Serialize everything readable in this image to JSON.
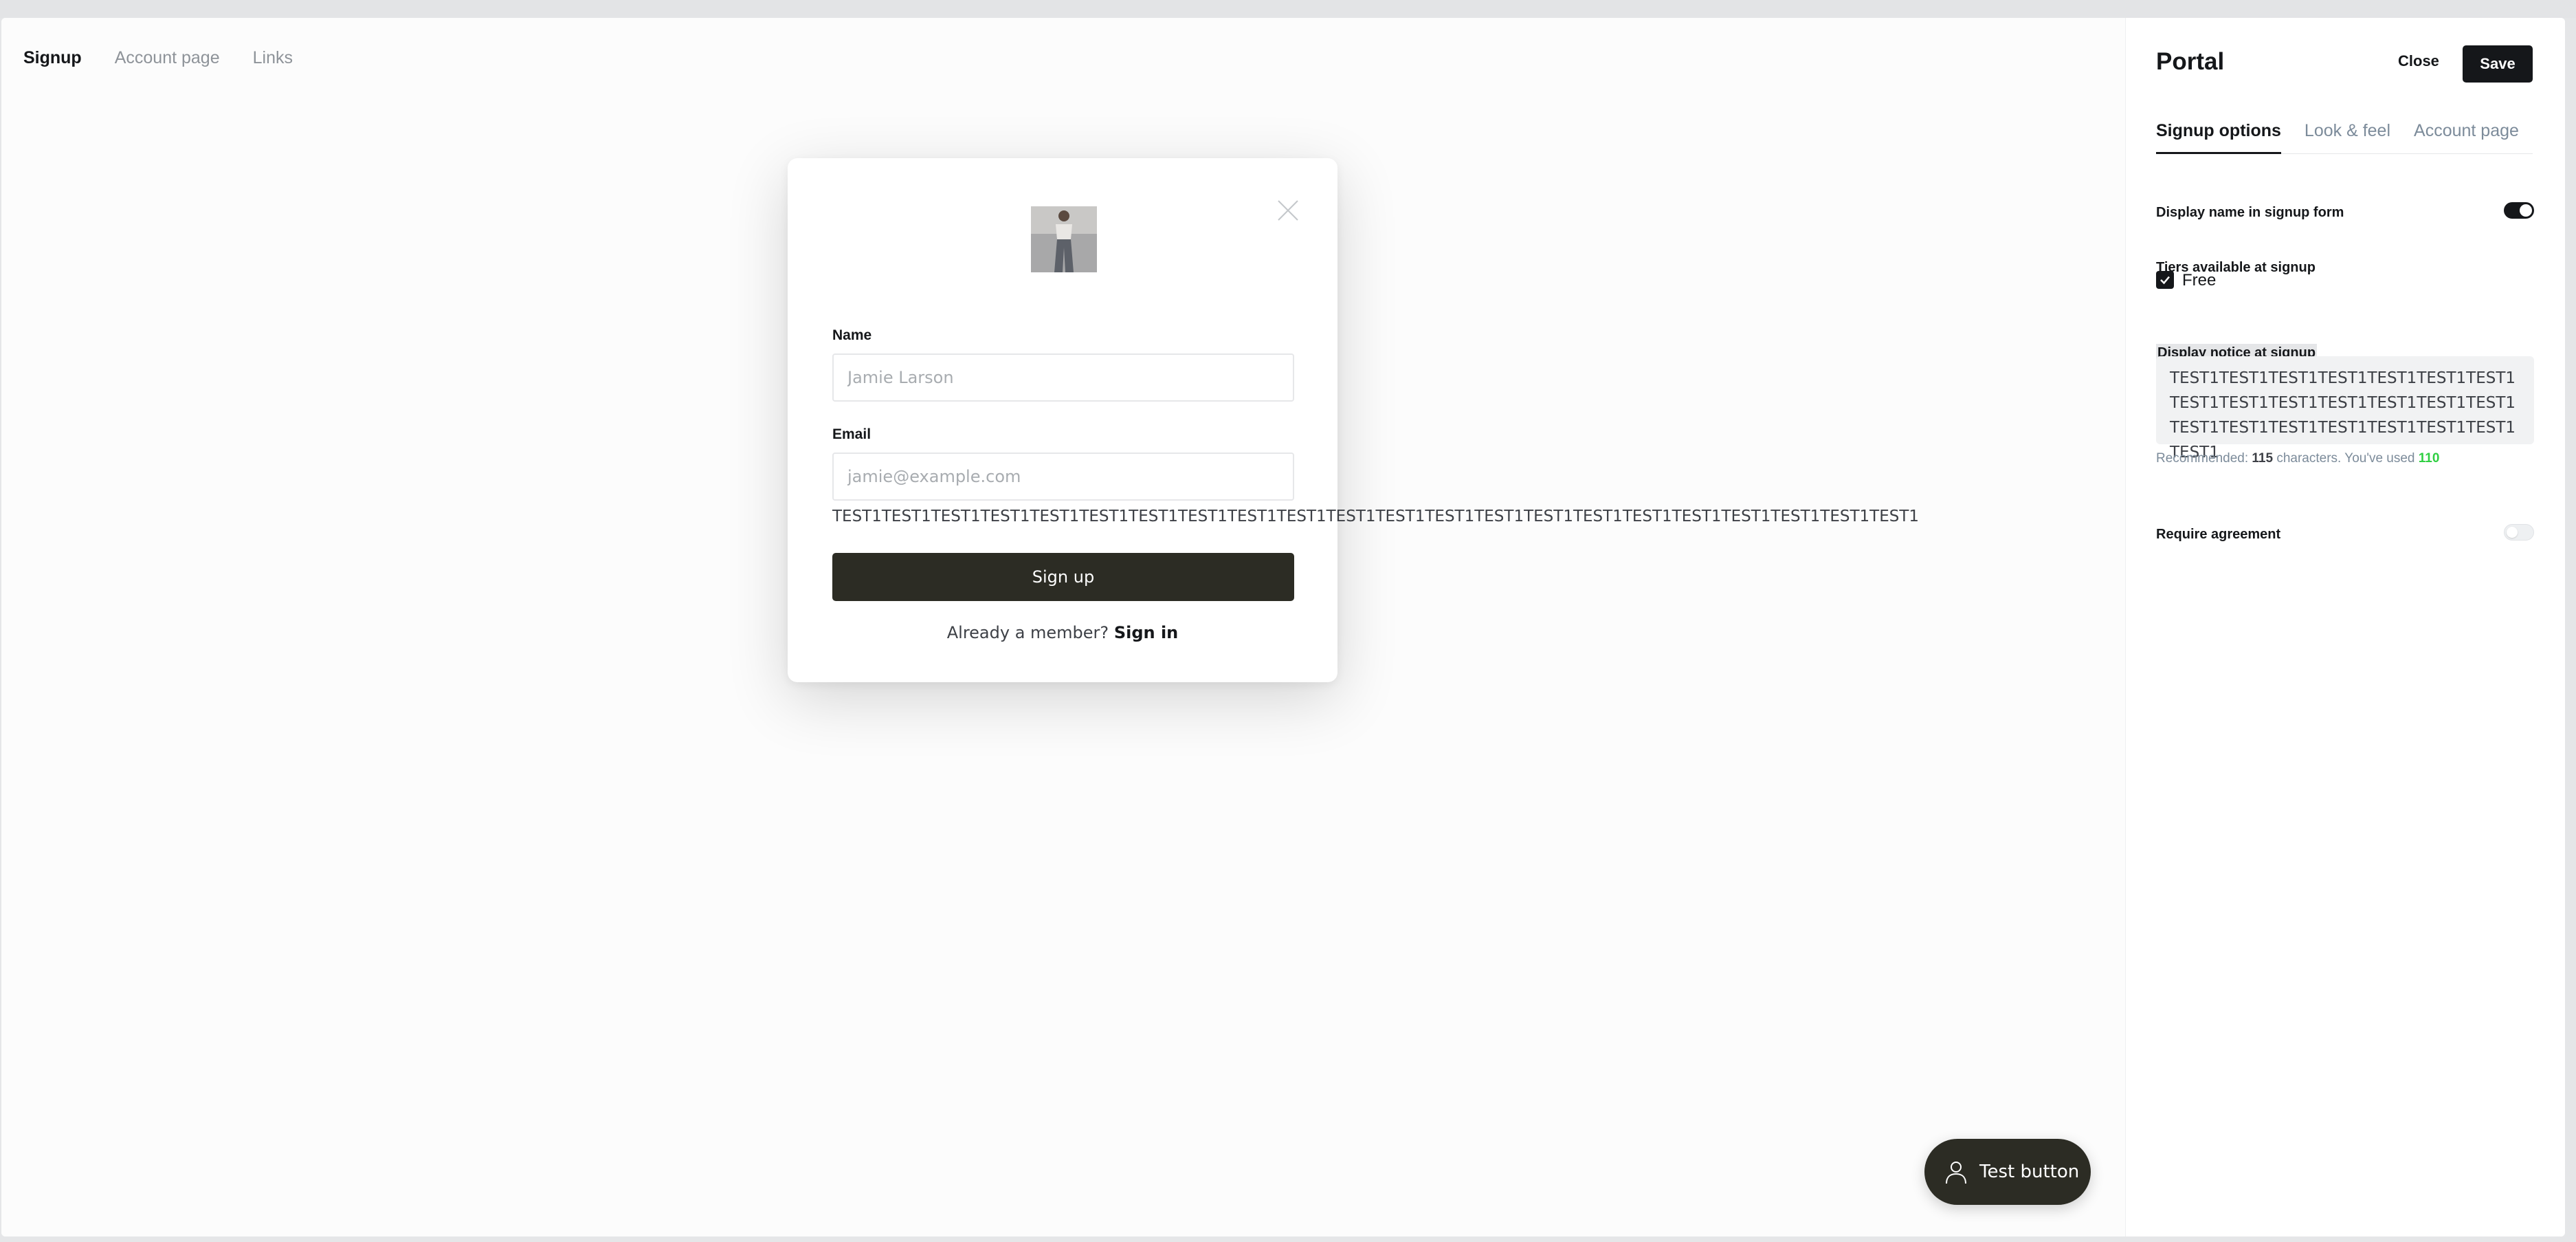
{
  "preview": {
    "tabs": [
      "Signup",
      "Account page",
      "Links"
    ],
    "active_tab": "Signup"
  },
  "modal": {
    "name_label": "Name",
    "name_placeholder": "Jamie Larson",
    "email_label": "Email",
    "email_placeholder": "jamie@example.com",
    "notice": "TEST1TEST1TEST1TEST1TEST1TEST1TEST1TEST1TEST1TEST1TEST1TEST1TEST1TEST1TEST1TEST1TEST1TEST1TEST1TEST1TEST1TEST1",
    "signup_button": "Sign up",
    "already_member": "Already a member?",
    "signin_link": "Sign in"
  },
  "test_button": {
    "label": "Test button"
  },
  "sidebar": {
    "title": "Portal",
    "close_label": "Close",
    "save_label": "Save",
    "tabs": [
      "Signup options",
      "Look & feel",
      "Account page"
    ],
    "display_name_label": "Display name in signup form",
    "display_name_enabled": true,
    "tiers_label": "Tiers available at signup",
    "tier_free_label": "Free",
    "tier_free_checked": true,
    "notice_label": "Display notice at signup",
    "notice_value": "TEST1TEST1TEST1TEST1TEST1TEST1TEST1TEST1TEST1TEST1TEST1TEST1TEST1TEST1TEST1TEST1TEST1TEST1TEST1TEST1TEST1TEST1",
    "hint_recommended": "Recommended:",
    "hint_count": "115",
    "hint_characters": "characters. You've used",
    "hint_used": "110",
    "require_agreement_label": "Require agreement",
    "require_agreement_enabled": false
  },
  "colors": {
    "accent_dark": "#2c2c24",
    "used_count_green": "#30cf43"
  }
}
